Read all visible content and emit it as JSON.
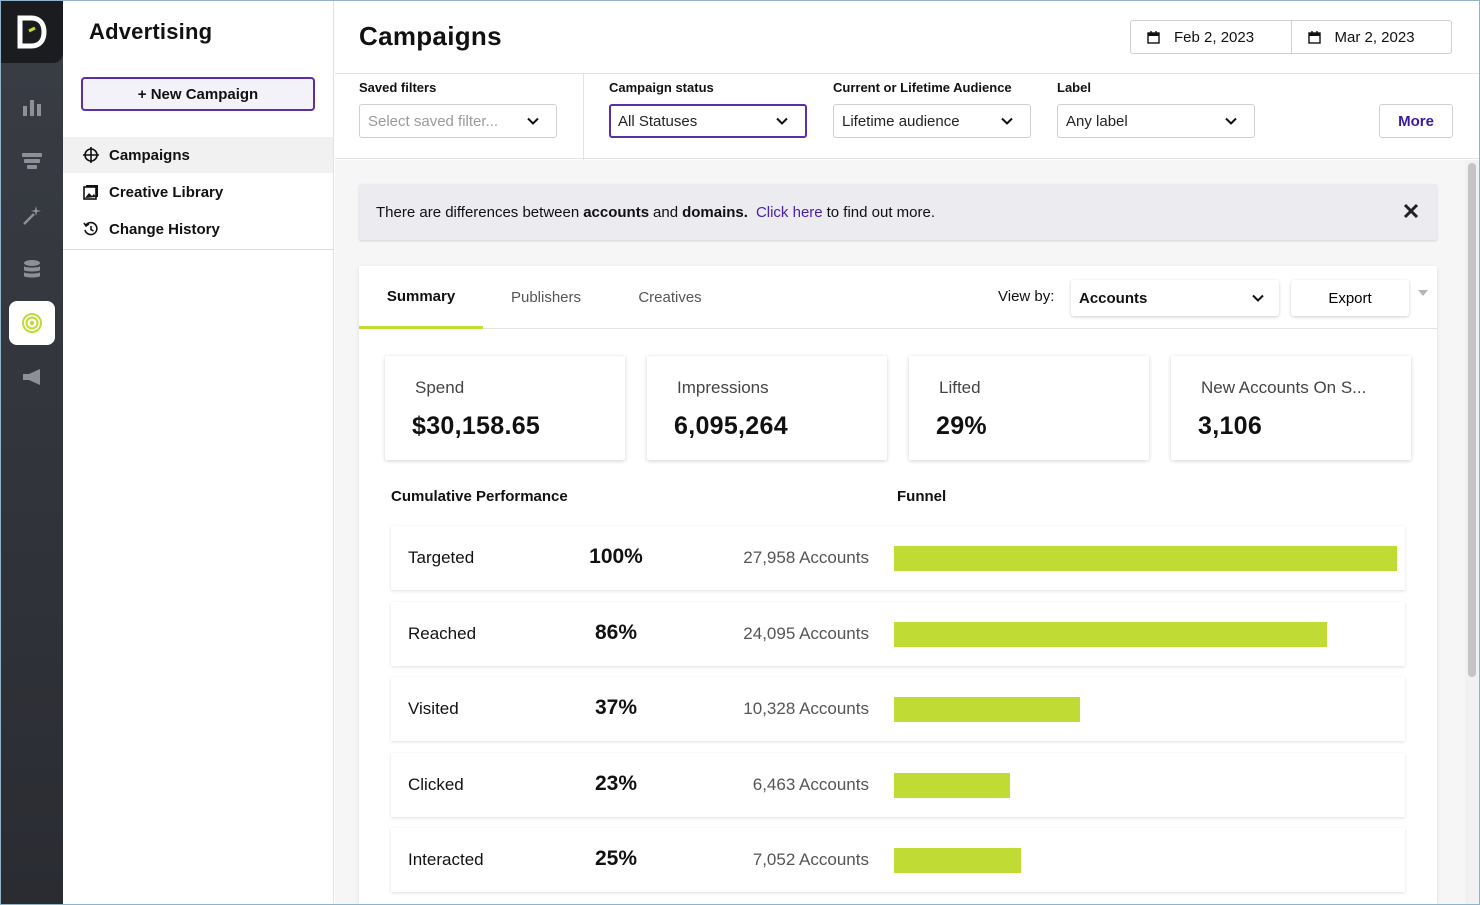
{
  "rail": {
    "items": [
      {
        "icon": "bar-chart-icon"
      },
      {
        "icon": "funnel-icon"
      },
      {
        "icon": "magic-wand-icon"
      },
      {
        "icon": "database-icon"
      },
      {
        "icon": "target-icon",
        "active": true
      },
      {
        "icon": "megaphone-icon"
      }
    ]
  },
  "sidebar": {
    "title": "Advertising",
    "new_campaign_label": "+ New Campaign",
    "items": [
      {
        "label": "Campaigns",
        "icon": "crosshair-icon",
        "active": true
      },
      {
        "label": "Creative Library",
        "icon": "image-icon"
      },
      {
        "label": "Change History",
        "icon": "history-icon"
      }
    ]
  },
  "header": {
    "title": "Campaigns",
    "date_start": "Feb 2, 2023",
    "date_end": "Mar 2, 2023"
  },
  "filters": {
    "saved": {
      "label": "Saved filters",
      "placeholder": "Select saved filter..."
    },
    "status": {
      "label": "Campaign status",
      "value": "All Statuses"
    },
    "audience": {
      "label": "Current or Lifetime Audience",
      "value": "Lifetime audience"
    },
    "tag": {
      "label": "Label",
      "value": "Any label"
    },
    "more_label": "More"
  },
  "banner": {
    "text_1": "There are differences between",
    "bold_1": "accounts",
    "text_2": "and",
    "bold_2": "domains.",
    "link": "Click here",
    "text_3": "to find out more."
  },
  "tabs": {
    "summary": "Summary",
    "publishers": "Publishers",
    "creatives": "Creatives"
  },
  "view_by": {
    "label": "View by:",
    "value": "Accounts"
  },
  "export_label": "Export",
  "stats": {
    "spend": {
      "label": "Spend",
      "value": "$30,158.65"
    },
    "impressions": {
      "label": "Impressions",
      "value": "6,095,264"
    },
    "lifted": {
      "label": "Lifted",
      "value": "29%"
    },
    "new_accounts": {
      "label": "New Accounts On S...",
      "value": "3,106"
    }
  },
  "sections": {
    "cumulative": "Cumulative Performance",
    "funnel": "Funnel"
  },
  "funnel": [
    {
      "name": "Targeted",
      "pct": "100%",
      "accounts": "27,958 Accounts",
      "count": 27958
    },
    {
      "name": "Reached",
      "pct": "86%",
      "accounts": "24,095 Accounts",
      "count": 24095
    },
    {
      "name": "Visited",
      "pct": "37%",
      "accounts": "10,328 Accounts",
      "count": 10328
    },
    {
      "name": "Clicked",
      "pct": "23%",
      "accounts": "6,463 Accounts",
      "count": 6463
    },
    {
      "name": "Interacted",
      "pct": "25%",
      "accounts": "7,052 Accounts",
      "count": 7052
    }
  ],
  "colors": {
    "accent": "#5a2ea6",
    "bar": "#c1db35",
    "link": "#4a1fa8"
  }
}
